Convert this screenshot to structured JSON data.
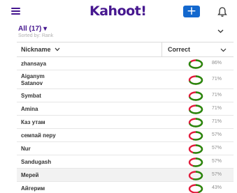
{
  "header": {
    "logo": "Kahoot!",
    "create_label": "+"
  },
  "filter": {
    "label": "All (17) ▾",
    "sort_note": "Sorted by: Rank"
  },
  "table": {
    "col_nickname": "Nickname",
    "col_correct": "Correct",
    "rows": [
      {
        "name": "zhansaya",
        "pct": "86%",
        "value": 0.86
      },
      {
        "name": "Aiganym\nSatanov",
        "pct": "71%",
        "value": 0.71
      },
      {
        "name": "Symbat",
        "pct": "71%",
        "value": 0.71
      },
      {
        "name": "Amina",
        "pct": "71%",
        "value": 0.71
      },
      {
        "name": "Каз утам",
        "pct": "71%",
        "value": 0.71
      },
      {
        "name": "семпай перу",
        "pct": "57%",
        "value": 0.57
      },
      {
        "name": "Nur",
        "pct": "57%",
        "value": 0.57
      },
      {
        "name": "Sandugash",
        "pct": "57%",
        "value": 0.57
      },
      {
        "name": "Мерей",
        "pct": "57%",
        "value": 0.57
      },
      {
        "name": "Айгерим",
        "pct": "43%",
        "value": 0.43
      }
    ]
  },
  "colors": {
    "brand": "#46178f",
    "button_blue": "#1368ce",
    "correct_green": "#26890c",
    "incorrect_red": "#e21b3c"
  }
}
